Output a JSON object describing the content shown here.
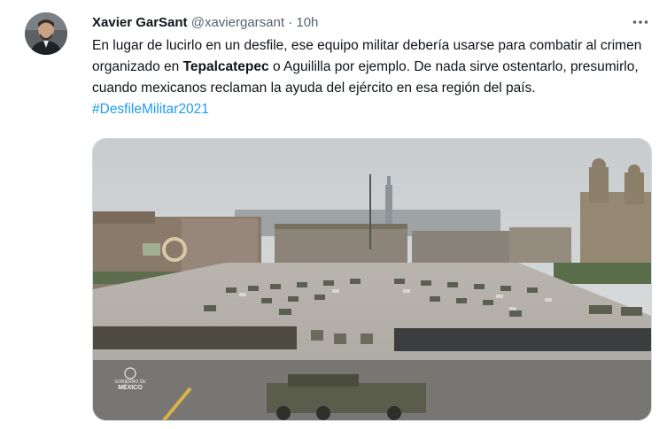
{
  "tweet": {
    "author_name": "Xavier GarSant",
    "author_handle": "@xaviergarsant",
    "separator": "·",
    "time": "10h",
    "text_part1": "En lugar de lucirlo en un desfile, ese equipo militar debería usarse para combatir al crimen organizado en ",
    "text_bold": "Tepalcatepec",
    "text_part2": " o Aguililla por ejemplo. De nada sirve ostentarlo, presumirlo, cuando mexicanos reclaman la ayuda del ejército en esa región del país. ",
    "hashtag": "#DesfileMilitar2021"
  },
  "media": {
    "logo_line1": "GOBIERNO DE",
    "logo_line2": "MÉXICO"
  },
  "icons": {
    "more": "more-dots-icon",
    "avatar": "user-avatar"
  },
  "colors": {
    "link": "#1d9bf0",
    "secondary_text": "#536471",
    "border": "#cfd9de"
  }
}
